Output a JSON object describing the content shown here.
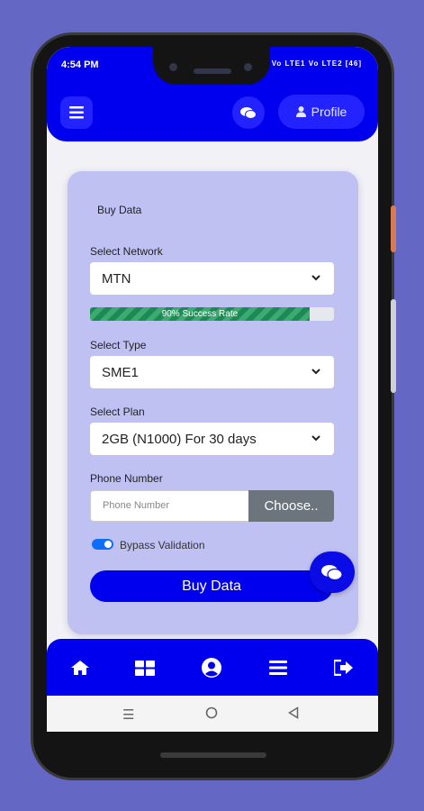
{
  "status_bar": {
    "time": "4:54 PM",
    "indicators": "Vo LTE1 Vo LTE2 [46]"
  },
  "header": {
    "menu_icon": "hamburger-icon",
    "chat_icon": "chat-icon",
    "profile_label": "Profile",
    "profile_icon": "user-icon"
  },
  "form": {
    "title": "Buy Data",
    "network_label": "Select Network",
    "network_value": "MTN",
    "success_rate_text": "90% Success Rate",
    "success_rate_fraction": 0.9,
    "type_label": "Select Type",
    "type_value": "SME1",
    "plan_label": "Select Plan",
    "plan_value": "2GB (N1000) For 30 days",
    "phone_label": "Phone Number",
    "phone_placeholder": "Phone Number",
    "choose_label": "Choose..",
    "bypass_label": "Bypass Validation",
    "bypass_enabled": true,
    "buy_label": "Buy Data"
  },
  "bottom_nav": {
    "items": [
      "home-icon",
      "grid-icon",
      "user-circle-icon",
      "list-icon",
      "logout-icon"
    ]
  },
  "system_nav": [
    "recents-icon",
    "home-circle-icon",
    "back-icon"
  ],
  "colors": {
    "primary": "#0000ee",
    "background": "#6467c4",
    "card": "#c0c1f3",
    "success": "#1b8a56"
  }
}
